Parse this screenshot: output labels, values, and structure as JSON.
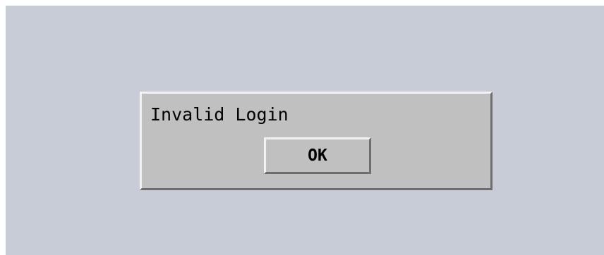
{
  "dialog": {
    "message": "Invalid Login",
    "ok_label": "OK"
  },
  "colors": {
    "background": "#c8ccd6",
    "dialog": "#c0c0c0",
    "bevel_light": "#f2f2f2",
    "bevel_dark": "#6e6e6e"
  }
}
